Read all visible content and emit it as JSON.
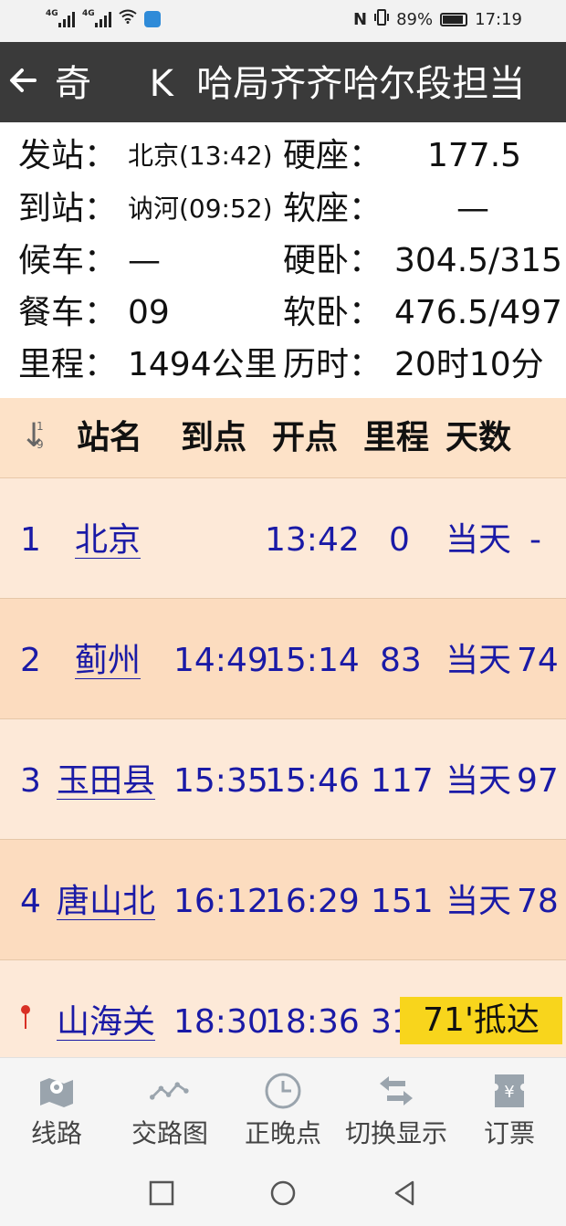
{
  "status_bar": {
    "left": {
      "sig1": "4G",
      "sig2": "4G"
    },
    "right": {
      "nfc": "N",
      "battery_percent": "89%",
      "time": "17:19"
    }
  },
  "title_bar": {
    "back_icon": "arrow-left-icon",
    "title": "奇     K  哈局齐齐哈尔段担当"
  },
  "info": {
    "depart_label": "发站：",
    "depart_value": "北京(13:42)",
    "hard_seat_label": "硬座：",
    "hard_seat_value": "177.5",
    "arrive_label": "到站：",
    "arrive_value": "讷河(09:52)",
    "soft_seat_label": "软座：",
    "soft_seat_value": "—",
    "waiting_label": "候车：",
    "waiting_value": "—",
    "hard_sleeper_label": "硬卧：",
    "hard_sleeper_value": "304.5/315",
    "dining_label": "餐车：",
    "dining_value": "09",
    "soft_sleeper_label": "软卧：",
    "soft_sleeper_value": "476.5/497",
    "mileage_label": "里程：",
    "mileage_value": "1494公里",
    "duration_label": "历时：",
    "duration_value": "20时10分"
  },
  "table": {
    "headers": {
      "station": "站名",
      "arrive": "到点",
      "depart": "开点",
      "mileage": "里程",
      "days": "天数"
    },
    "rows": [
      {
        "no": "1",
        "station": "北京",
        "arrive": "",
        "depart": "13:42",
        "mileage": "0",
        "day": "当天",
        "extra": "-"
      },
      {
        "no": "2",
        "station": "蓟州",
        "arrive": "14:49",
        "depart": "15:14",
        "mileage": "83",
        "day": "当天",
        "extra": "74"
      },
      {
        "no": "3",
        "station": "玉田县",
        "arrive": "15:35",
        "depart": "15:46",
        "mileage": "117",
        "day": "当天",
        "extra": "97"
      },
      {
        "no": "4",
        "station": "唐山北",
        "arrive": "16:12",
        "depart": "16:29",
        "mileage": "151",
        "day": "当天",
        "extra": "78"
      },
      {
        "no": "",
        "station": "山海关",
        "arrive": "18:30",
        "depart": "18:36",
        "mileage": "31",
        "late": "71'抵达"
      }
    ]
  },
  "bottom_nav": {
    "items": [
      {
        "label": "线路",
        "icon": "map-icon"
      },
      {
        "label": "交路图",
        "icon": "route-chart-icon"
      },
      {
        "label": "正晚点",
        "icon": "clock-icon"
      },
      {
        "label": "切换显示",
        "icon": "swap-icon"
      },
      {
        "label": "订票",
        "icon": "ticket-icon"
      }
    ]
  },
  "colors": {
    "title_bg": "#3a3a3a",
    "row_odd": "#fde9d8",
    "row_even": "#fcdcbf",
    "header_bg": "#fde2c8",
    "link": "#1a1aa6",
    "late_badge": "#f8d51c"
  }
}
